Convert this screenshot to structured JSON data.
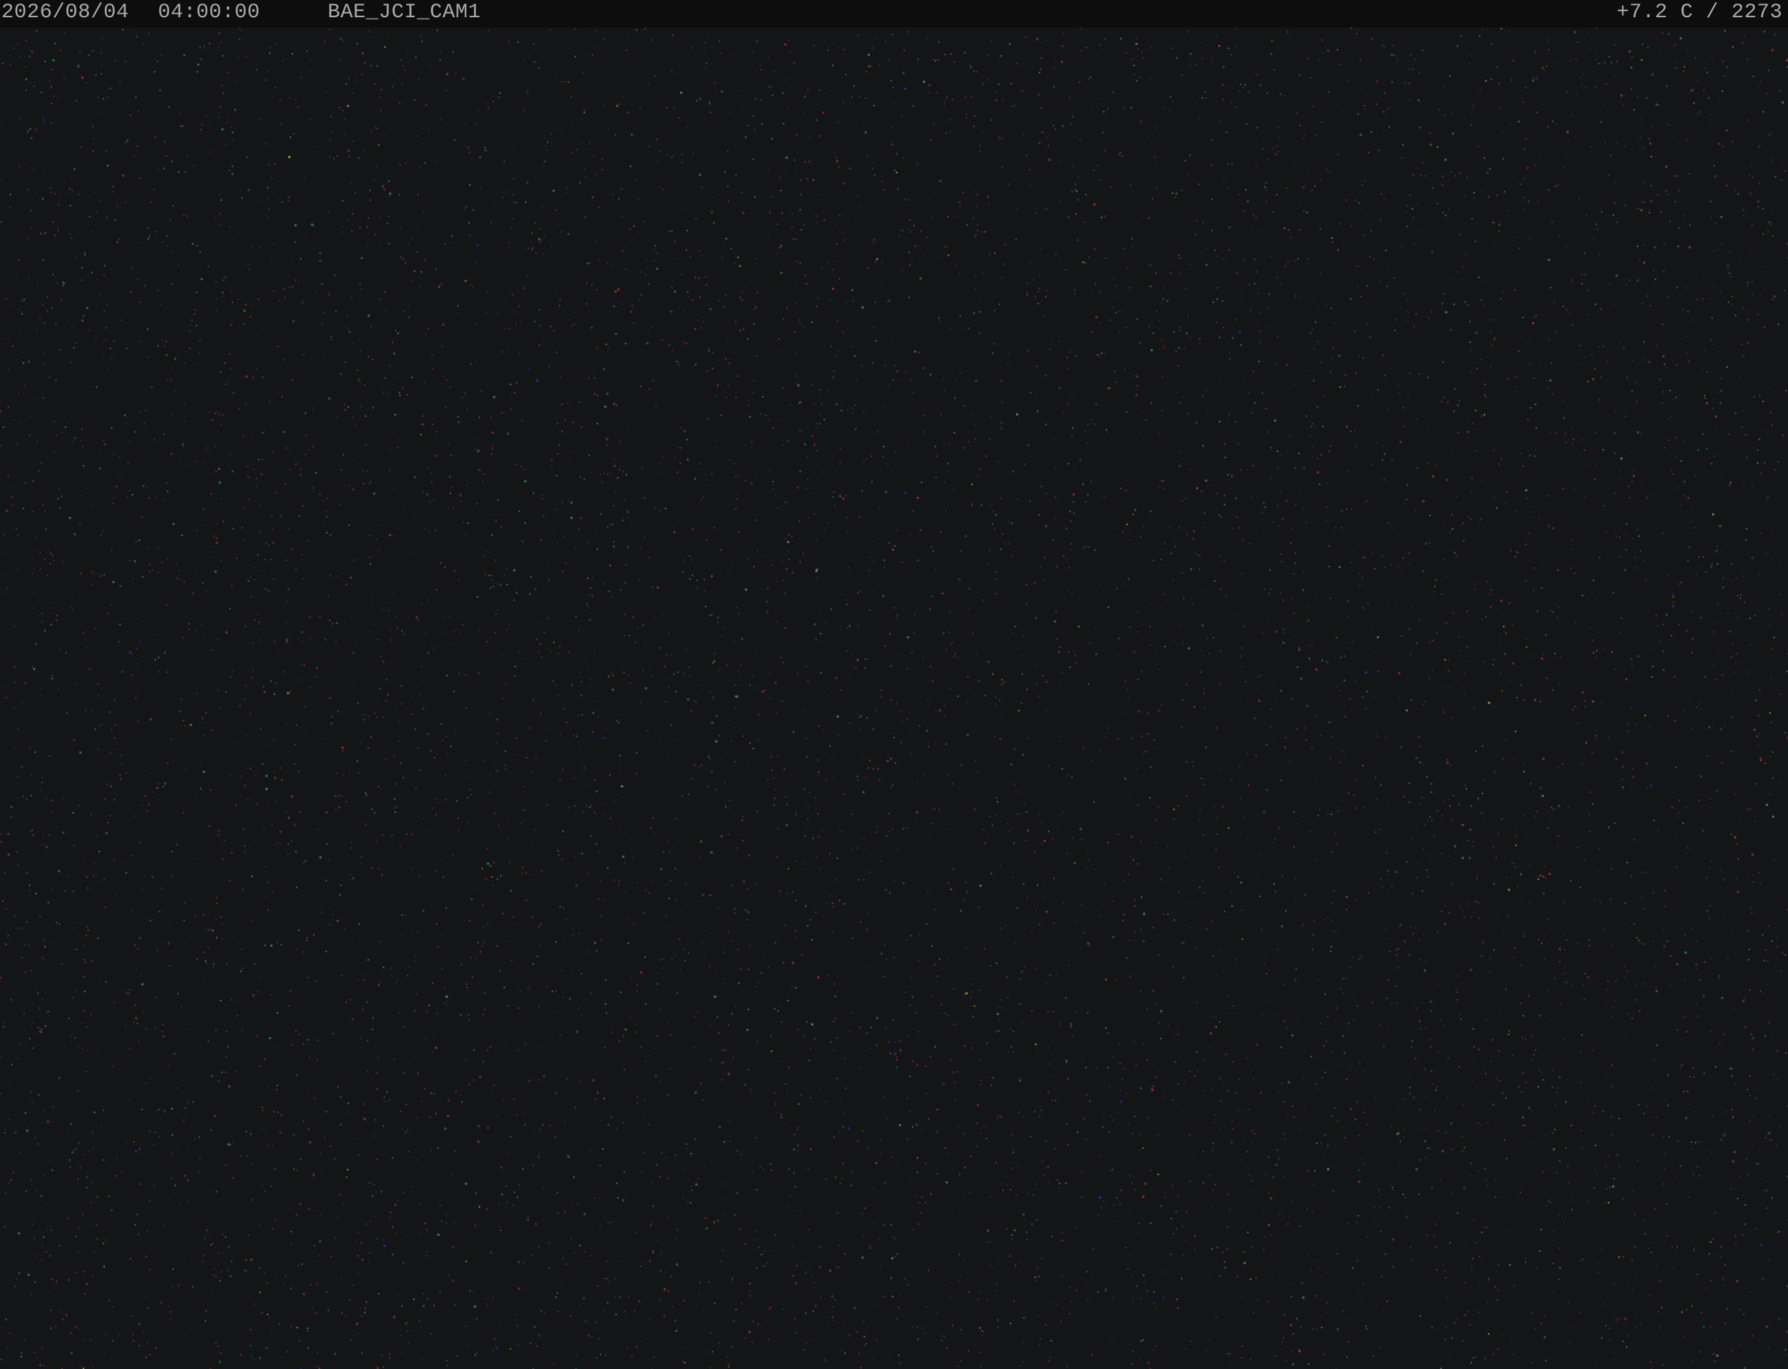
{
  "overlay": {
    "date": "2026/08/04",
    "time": "04:00:00",
    "camera_id": "BAE_JCI_CAM1",
    "temperature_reading": "+7.2 C / 2273"
  },
  "scene": {
    "description_type": "night-sky-camera-frame",
    "background_color": "#141516",
    "noise_colors": [
      "#b03a48",
      "#3a3ab0",
      "#3aa05a",
      "#c8c850",
      "#8a8a8a"
    ]
  }
}
